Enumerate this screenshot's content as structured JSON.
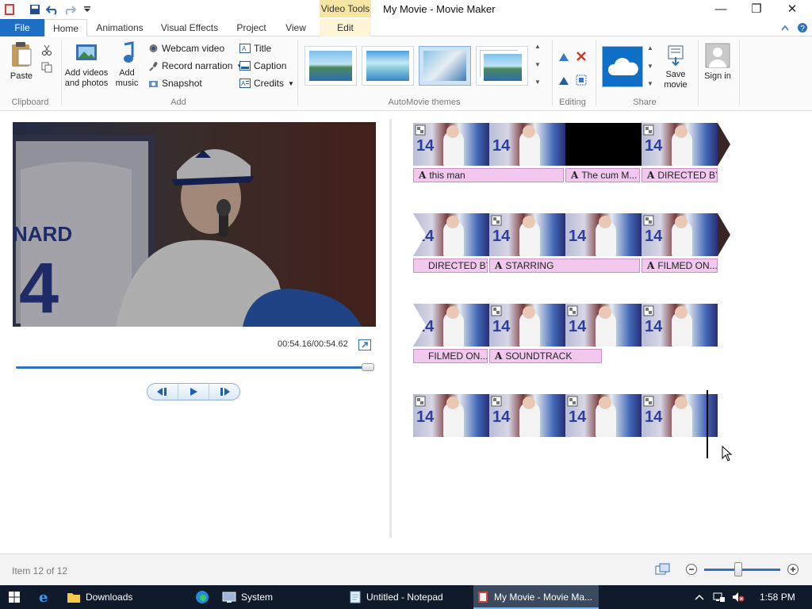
{
  "window": {
    "title": "My Movie - Movie Maker",
    "context_tab_group": "Video Tools",
    "minimize": "—",
    "restore": "❐",
    "close": "✕"
  },
  "tabs": [
    "File",
    "Home",
    "Animations",
    "Visual Effects",
    "Project",
    "View"
  ],
  "context_tab": "Edit",
  "ribbon": {
    "clipboard": {
      "label": "Clipboard",
      "paste": "Paste"
    },
    "add": {
      "label": "Add",
      "add_videos": "Add videos and photos",
      "add_music": "Add music",
      "webcam": "Webcam video",
      "narration": "Record narration",
      "snapshot": "Snapshot",
      "title": "Title",
      "caption": "Caption",
      "credits": "Credits"
    },
    "themes": {
      "label": "AutoMovie themes",
      "count": 4,
      "selected": 2
    },
    "editing": {
      "label": "Editing"
    },
    "share": {
      "label": "Share",
      "save_movie": "Save movie",
      "sign_in": "Sign in"
    }
  },
  "player": {
    "time": "00:54.16/00:54.62",
    "progress": 0.99
  },
  "storyboard": {
    "rows": [
      {
        "captions": [
          {
            "text": "this man",
            "icon": true
          },
          {
            "text": "The cum M...",
            "icon": true
          },
          {
            "text": "DIRECTED BY",
            "icon": true
          }
        ]
      },
      {
        "captions": [
          {
            "text": "DIRECTED BY",
            "icon": false
          },
          {
            "text": "STARRING",
            "icon": true
          },
          {
            "text": "FILMED ON...",
            "icon": true
          }
        ]
      },
      {
        "captions": [
          {
            "text": "FILMED ON...",
            "icon": false
          },
          {
            "text": "SOUNDTRACK",
            "icon": true
          }
        ]
      }
    ],
    "jersey_text": "14"
  },
  "status": {
    "item": "Item 12 of 12",
    "zoom": 0.45
  },
  "taskbar": {
    "downloads": "Downloads",
    "system": "System",
    "notepad": "Untitled - Notepad",
    "moviemaker": "My Movie - Movie Ma...",
    "clock": "1:58 PM"
  }
}
